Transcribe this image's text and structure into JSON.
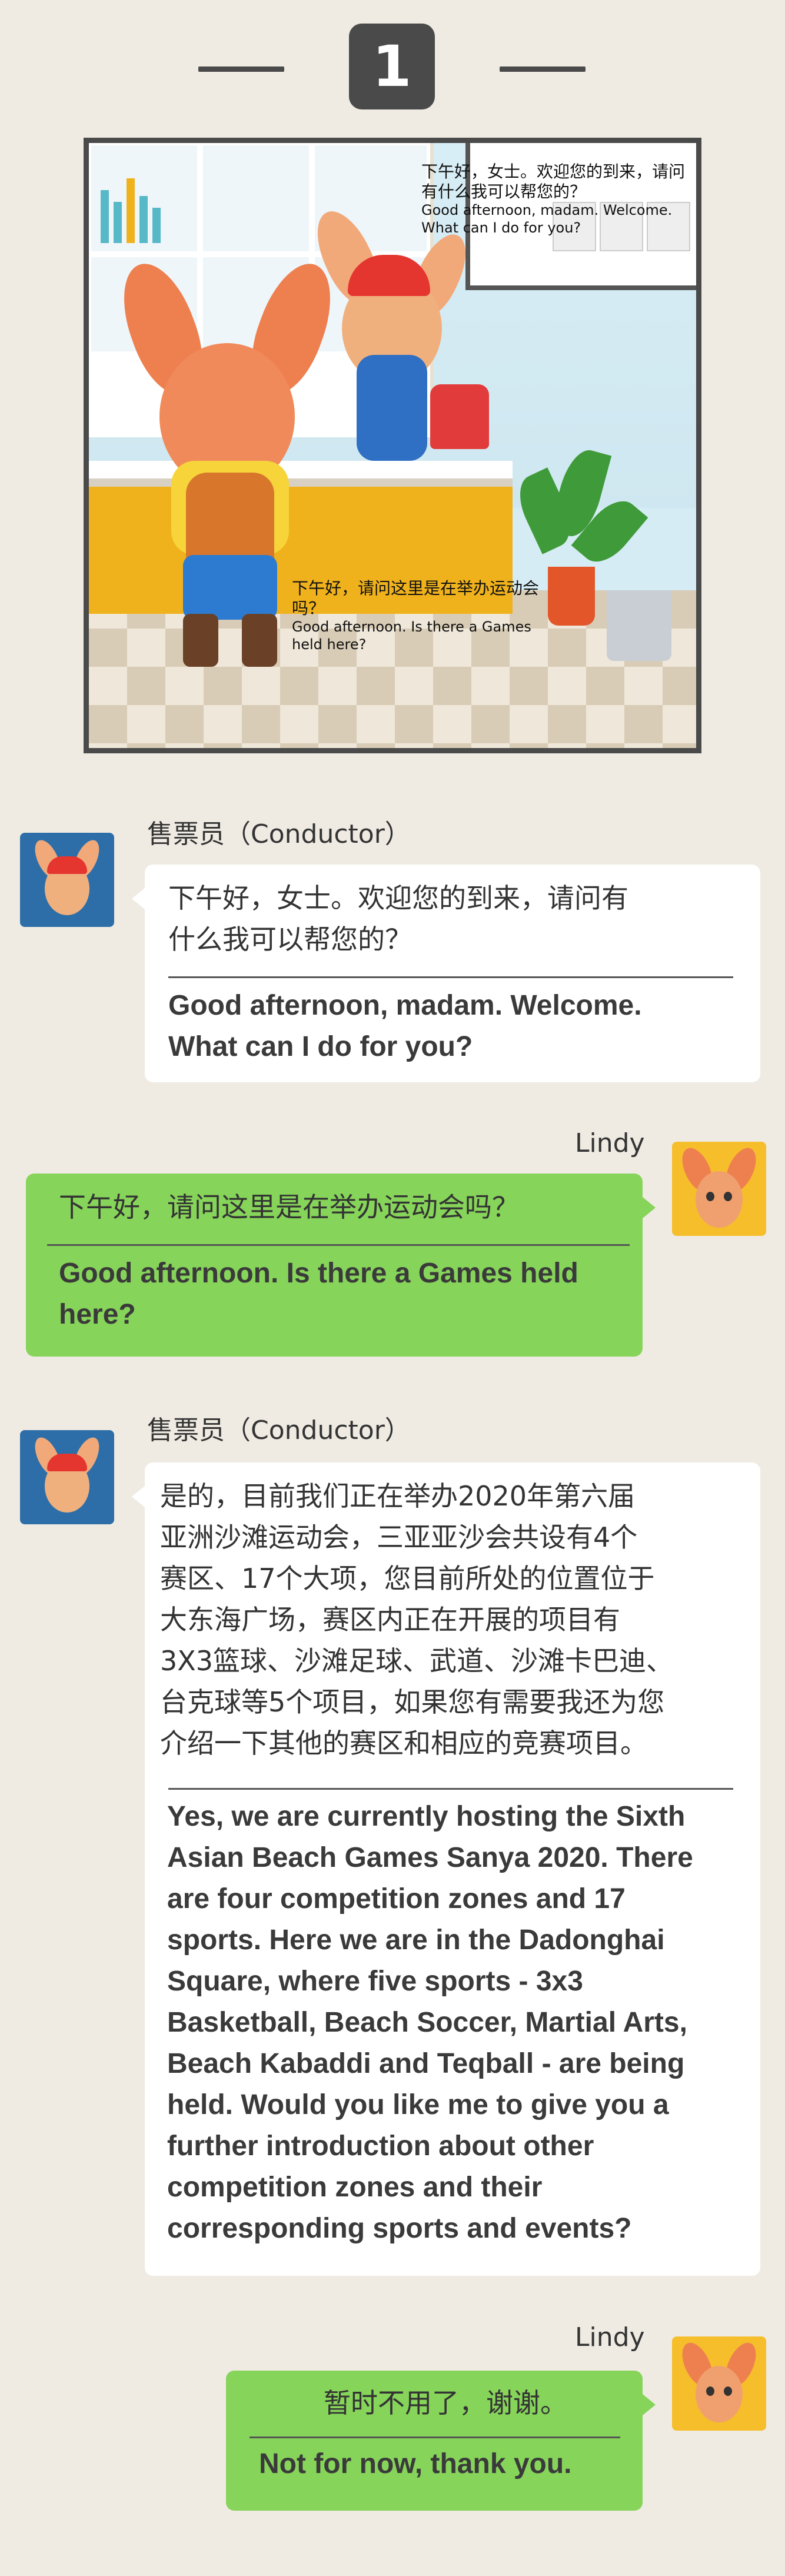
{
  "header": {
    "step_number": "1"
  },
  "scene": {
    "conductor_bubble_zh": "下午好，女士。欢迎您的到来，请问有什么我可以帮您的？",
    "conductor_bubble_en": "Good afternoon, madam. Welcome. What can I do for you?",
    "lindy_bubble_zh": "下午好，请问这里是在举办运动会吗？",
    "lindy_bubble_en": "Good afternoon. Is there a Games held here?"
  },
  "messages": [
    {
      "speaker": "售票员（Conductor）",
      "side": "left",
      "avatar": "conductor-deer-avatar",
      "zh": "下午好，女士。欢迎您的到来，请问有\n什么我可以帮您的？",
      "en": "Good afternoon, madam. Welcome.\nWhat can I do for you?"
    },
    {
      "speaker": "Lindy",
      "side": "right",
      "avatar": "lindy-deer-avatar",
      "zh": "下午好，请问这里是在举办运动会吗？",
      "en": "Good afternoon. Is there a Games held\nhere?"
    },
    {
      "speaker": "售票员（Conductor）",
      "side": "left",
      "avatar": "conductor-deer-avatar",
      "zh": "是的，目前我们正在举办2020年第六届\n亚洲沙滩运动会，三亚亚沙会共设有4个\n赛区、17个大项，您目前所处的位置位于\n大东海广场，赛区内正在开展的项目有\n3X3篮球、沙滩足球、武道、沙滩卡巴迪、\n台克球等5个项目，如果您有需要我还为您\n介绍一下其他的赛区和相应的竞赛项目。",
      "en": "Yes, we are currently hosting the Sixth\nAsian Beach Games Sanya 2020. There\nare four competition zones and 17\nsports. Here we are in the Dadonghai\nSquare, where five sports - 3x3\nBasketball, Beach Soccer, Martial Arts,\nBeach Kabaddi and Teqball - are being\nheld. Would you like me to give you a\nfurther introduction about other\ncompetition zones and their\ncorresponding sports and events?"
    },
    {
      "speaker": "Lindy",
      "side": "right",
      "avatar": "lindy-deer-avatar",
      "zh": "暂时不用了，谢谢。",
      "en": "Not for now, thank you."
    }
  ],
  "colors": {
    "background": "#efebe3",
    "dark": "#4a4a4a",
    "green_bubble": "#86d45a",
    "white_bubble": "#ffffff",
    "conductor_avatar_bg": "#2d6ea8",
    "lindy_avatar_bg": "#f6be2b"
  }
}
